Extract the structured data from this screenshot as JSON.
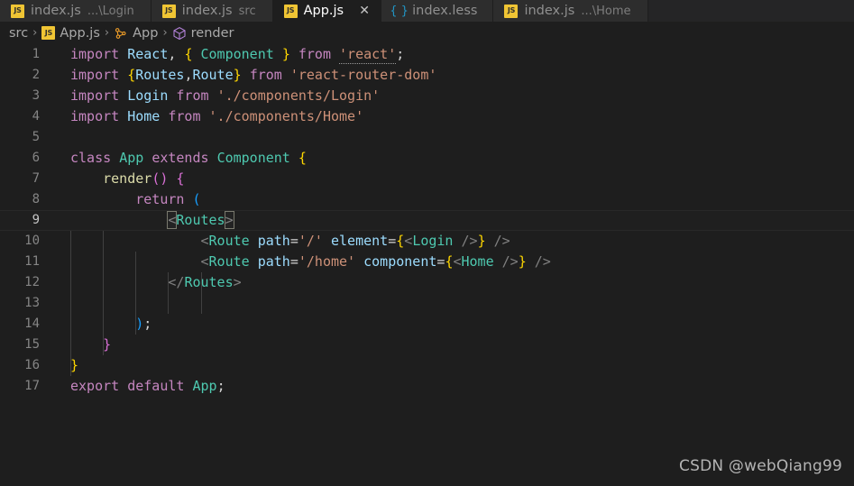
{
  "window": {
    "theme_bg": "#1e1e1e",
    "tabbar_bg": "#252526",
    "accent": "#f0c534"
  },
  "tabs": [
    {
      "icon": "js-file-icon",
      "icon_text": "JS",
      "label": "index.js",
      "description": "...\\Login",
      "active": false,
      "close_glyph": ""
    },
    {
      "icon": "js-file-icon",
      "icon_text": "JS",
      "label": "index.js",
      "description": "src",
      "active": false,
      "close_glyph": ""
    },
    {
      "icon": "js-file-icon",
      "icon_text": "JS",
      "label": "App.js",
      "description": "",
      "active": true,
      "close_glyph": "✕"
    },
    {
      "icon": "less-file-icon",
      "icon_text": "{ }",
      "label": "index.less",
      "description": "",
      "active": false,
      "close_glyph": ""
    },
    {
      "icon": "js-file-icon",
      "icon_text": "JS",
      "label": "index.js",
      "description": "...\\Home",
      "active": false,
      "close_glyph": ""
    }
  ],
  "breadcrumb": {
    "separator": "›",
    "items": [
      {
        "icon": "",
        "icon_text": "",
        "label": "src"
      },
      {
        "icon": "js-file-icon",
        "icon_text": "JS",
        "label": "App.js"
      },
      {
        "icon": "class-symbol-icon",
        "icon_text": "",
        "label": "App"
      },
      {
        "icon": "method-symbol-icon",
        "icon_text": "",
        "label": "render"
      }
    ]
  },
  "editor": {
    "language": "javascript",
    "current_line": 9,
    "first_line_number": 1,
    "last_line_number": 17,
    "lines": [
      {
        "n": "1",
        "text": "import React, { Component } from 'react';"
      },
      {
        "n": "2",
        "text": "import {Routes,Route} from 'react-router-dom'"
      },
      {
        "n": "3",
        "text": "import Login from './components/Login'"
      },
      {
        "n": "4",
        "text": "import Home from './components/Home'"
      },
      {
        "n": "5",
        "text": ""
      },
      {
        "n": "6",
        "text": "class App extends Component {"
      },
      {
        "n": "7",
        "text": "    render() {"
      },
      {
        "n": "8",
        "text": "        return ("
      },
      {
        "n": "9",
        "text": "            <Routes>"
      },
      {
        "n": "10",
        "text": "                <Route path='/' element={<Login />} />"
      },
      {
        "n": "11",
        "text": "                <Route path='/home' component={<Home />} />"
      },
      {
        "n": "12",
        "text": "            </Routes>"
      },
      {
        "n": "13",
        "text": ""
      },
      {
        "n": "14",
        "text": "        );"
      },
      {
        "n": "15",
        "text": "    }"
      },
      {
        "n": "16",
        "text": "}"
      },
      {
        "n": "17",
        "text": "export default App;"
      }
    ]
  },
  "watermark": {
    "text": "CSDN @webQiang99"
  }
}
